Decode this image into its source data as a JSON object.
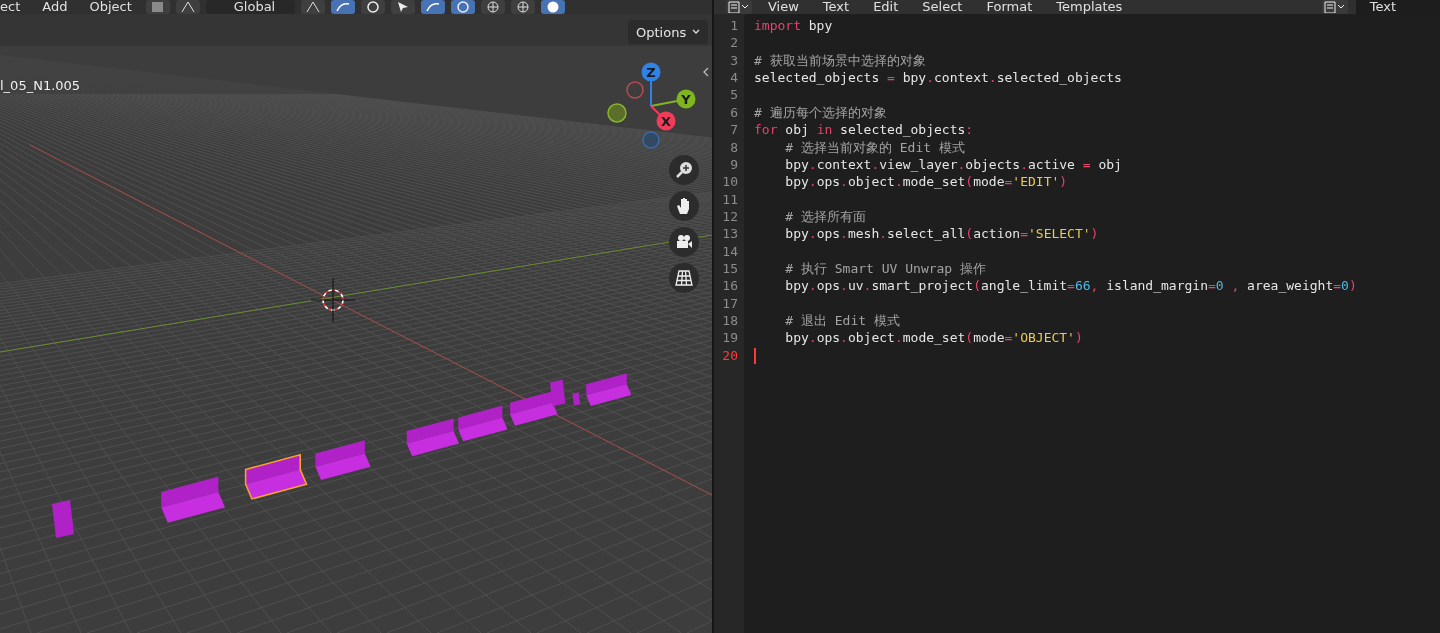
{
  "viewport_header": {
    "menus": [
      "ect",
      "Add",
      "Object"
    ],
    "orientation": "Global",
    "tools": [
      {
        "kind": "checker",
        "active": false
      },
      {
        "kind": "transform",
        "active": false
      },
      {
        "kind": "pivot",
        "active": false
      },
      {
        "kind": "snap",
        "active": true
      },
      {
        "kind": "proportional",
        "active": false
      },
      {
        "kind": "select",
        "active": false
      },
      {
        "kind": "gizmo",
        "active": true
      },
      {
        "kind": "overlay",
        "active": true
      },
      {
        "kind": "xray",
        "active": false
      },
      {
        "kind": "wire",
        "active": false
      },
      {
        "kind": "solid",
        "active": true
      }
    ]
  },
  "viewport": {
    "options": "Options",
    "object_name": "l_05_N1.005",
    "axes": [
      {
        "label": "Z",
        "color": "#2f83e6"
      },
      {
        "label": "Y",
        "color": "#7fb51f"
      },
      {
        "label": "X",
        "color": "#f03c5a"
      }
    ],
    "objects": [
      {
        "kind": "panel",
        "selected": false
      },
      {
        "kind": "bracket",
        "selected": false
      },
      {
        "kind": "bracket",
        "selected": true
      },
      {
        "kind": "bracket",
        "selected": false
      },
      {
        "kind": "bracket",
        "selected": false
      },
      {
        "kind": "bracket",
        "selected": false
      },
      {
        "kind": "bracket",
        "selected": false
      },
      {
        "kind": "panel",
        "selected": false
      },
      {
        "kind": "panel",
        "selected": false
      },
      {
        "kind": "bracket",
        "selected": false
      }
    ]
  },
  "text_editor": {
    "menus": [
      "View",
      "Text",
      "Edit",
      "Select",
      "Format",
      "Templates"
    ],
    "datablock": "Text",
    "lines": [
      {
        "number": "1",
        "current": false,
        "tokens": [
          {
            "kind": "keyword",
            "text": "import"
          },
          {
            "kind": "plain",
            "text": " bpy"
          }
        ]
      },
      {
        "number": "2",
        "current": false
      },
      {
        "number": "3",
        "current": false,
        "tokens": [
          {
            "kind": "comment",
            "text": "# 获取当前场景中选择的对象"
          }
        ]
      },
      {
        "number": "4",
        "current": false,
        "tokens": [
          {
            "kind": "plain",
            "text": "selected_objects "
          },
          {
            "kind": "op",
            "text": "="
          },
          {
            "kind": "plain",
            "text": " bpy"
          },
          {
            "kind": "op",
            "text": "."
          },
          {
            "kind": "plain",
            "text": "context"
          },
          {
            "kind": "op",
            "text": "."
          },
          {
            "kind": "plain",
            "text": "selected_objects"
          }
        ]
      },
      {
        "number": "5",
        "current": false
      },
      {
        "number": "6",
        "current": false,
        "tokens": [
          {
            "kind": "comment",
            "text": "# 遍历每个选择的对象"
          }
        ]
      },
      {
        "number": "7",
        "current": false,
        "tokens": [
          {
            "kind": "keyword",
            "text": "for"
          },
          {
            "kind": "plain",
            "text": " obj "
          },
          {
            "kind": "keyword",
            "text": "in"
          },
          {
            "kind": "plain",
            "text": " selected_objects"
          },
          {
            "kind": "op",
            "text": ":"
          }
        ]
      },
      {
        "number": "8",
        "current": false,
        "tokens": [
          {
            "kind": "comment",
            "text": "    # 选择当前对象的 Edit 模式"
          }
        ]
      },
      {
        "number": "9",
        "current": false,
        "tokens": [
          {
            "kind": "plain",
            "text": "    bpy"
          },
          {
            "kind": "op",
            "text": "."
          },
          {
            "kind": "plain",
            "text": "context"
          },
          {
            "kind": "op",
            "text": "."
          },
          {
            "kind": "plain",
            "text": "view_layer"
          },
          {
            "kind": "op",
            "text": "."
          },
          {
            "kind": "plain",
            "text": "objects"
          },
          {
            "kind": "op",
            "text": "."
          },
          {
            "kind": "plain",
            "text": "active "
          },
          {
            "kind": "op",
            "text": "="
          },
          {
            "kind": "plain",
            "text": " obj"
          }
        ]
      },
      {
        "number": "10",
        "current": false,
        "tokens": [
          {
            "kind": "plain",
            "text": "    bpy"
          },
          {
            "kind": "op",
            "text": "."
          },
          {
            "kind": "plain",
            "text": "ops"
          },
          {
            "kind": "op",
            "text": "."
          },
          {
            "kind": "plain",
            "text": "object"
          },
          {
            "kind": "op",
            "text": "."
          },
          {
            "kind": "plain",
            "text": "mode_set"
          },
          {
            "kind": "op",
            "text": "("
          },
          {
            "kind": "plain",
            "text": "mode"
          },
          {
            "kind": "op",
            "text": "="
          },
          {
            "kind": "string",
            "text": "'EDIT'"
          },
          {
            "kind": "op",
            "text": ")"
          }
        ]
      },
      {
        "number": "11",
        "current": false
      },
      {
        "number": "12",
        "current": false,
        "tokens": [
          {
            "kind": "comment",
            "text": "    # 选择所有面"
          }
        ]
      },
      {
        "number": "13",
        "current": false,
        "tokens": [
          {
            "kind": "plain",
            "text": "    bpy"
          },
          {
            "kind": "op",
            "text": "."
          },
          {
            "kind": "plain",
            "text": "ops"
          },
          {
            "kind": "op",
            "text": "."
          },
          {
            "kind": "plain",
            "text": "mesh"
          },
          {
            "kind": "op",
            "text": "."
          },
          {
            "kind": "plain",
            "text": "select_all"
          },
          {
            "kind": "op",
            "text": "("
          },
          {
            "kind": "plain",
            "text": "action"
          },
          {
            "kind": "op",
            "text": "="
          },
          {
            "kind": "string",
            "text": "'SELECT'"
          },
          {
            "kind": "op",
            "text": ")"
          }
        ]
      },
      {
        "number": "14",
        "current": false
      },
      {
        "number": "15",
        "current": false,
        "tokens": [
          {
            "kind": "comment",
            "text": "    # 执行 Smart UV Unwrap 操作"
          }
        ]
      },
      {
        "number": "16",
        "current": false,
        "tokens": [
          {
            "kind": "plain",
            "text": "    bpy"
          },
          {
            "kind": "op",
            "text": "."
          },
          {
            "kind": "plain",
            "text": "ops"
          },
          {
            "kind": "op",
            "text": "."
          },
          {
            "kind": "plain",
            "text": "uv"
          },
          {
            "kind": "op",
            "text": "."
          },
          {
            "kind": "plain",
            "text": "smart_project"
          },
          {
            "kind": "op",
            "text": "("
          },
          {
            "kind": "plain",
            "text": "angle_limit"
          },
          {
            "kind": "op",
            "text": "="
          },
          {
            "kind": "number",
            "text": "66"
          },
          {
            "kind": "op",
            "text": ","
          },
          {
            "kind": "plain",
            "text": " island_margin"
          },
          {
            "kind": "op",
            "text": "="
          },
          {
            "kind": "number",
            "text": "0"
          },
          {
            "kind": "op",
            "text": " ,"
          },
          {
            "kind": "plain",
            "text": " area_weight"
          },
          {
            "kind": "op",
            "text": "="
          },
          {
            "kind": "number",
            "text": "0"
          },
          {
            "kind": "op",
            "text": ")"
          }
        ]
      },
      {
        "number": "17",
        "current": false
      },
      {
        "number": "18",
        "current": false,
        "tokens": [
          {
            "kind": "comment",
            "text": "    # 退出 Edit 模式"
          }
        ]
      },
      {
        "number": "19",
        "current": false,
        "tokens": [
          {
            "kind": "plain",
            "text": "    bpy"
          },
          {
            "kind": "op",
            "text": "."
          },
          {
            "kind": "plain",
            "text": "ops"
          },
          {
            "kind": "op",
            "text": "."
          },
          {
            "kind": "plain",
            "text": "object"
          },
          {
            "kind": "op",
            "text": "."
          },
          {
            "kind": "plain",
            "text": "mode_set"
          },
          {
            "kind": "op",
            "text": "("
          },
          {
            "kind": "plain",
            "text": "mode"
          },
          {
            "kind": "op",
            "text": "="
          },
          {
            "kind": "string",
            "text": "'OBJECT'"
          },
          {
            "kind": "op",
            "text": ")"
          }
        ]
      },
      {
        "number": "20",
        "current": true
      }
    ]
  }
}
